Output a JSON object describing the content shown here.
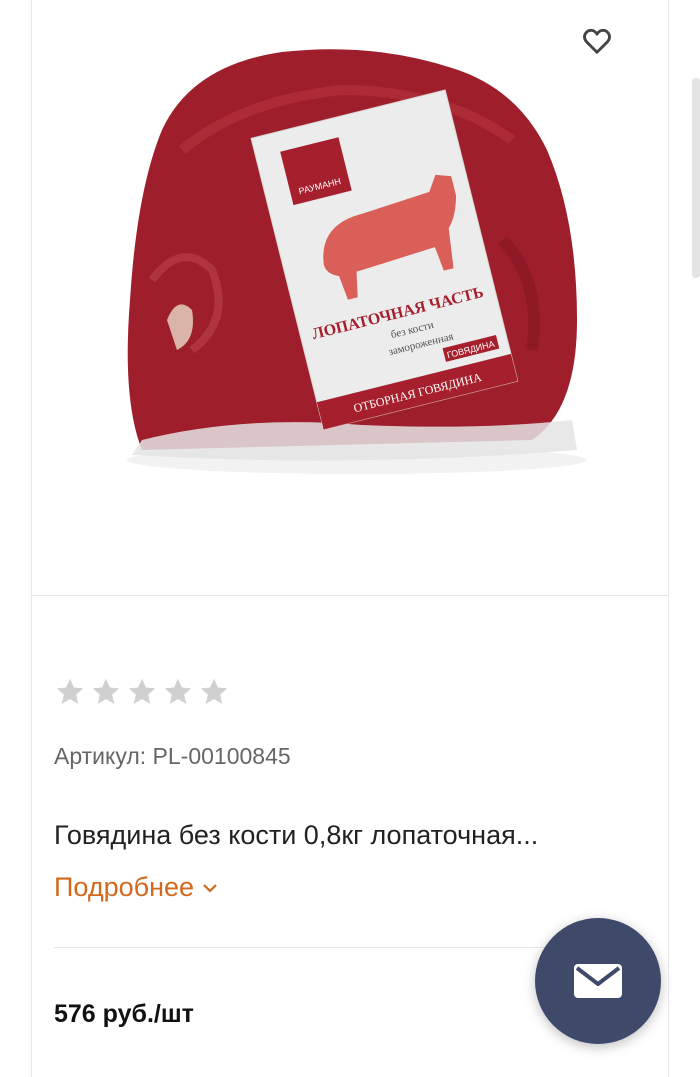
{
  "product": {
    "sku": "Артикул: PL-00100845",
    "title": "Говядина без кости 0,8кг лопаточная...",
    "more_label": "Подробнее",
    "price": "576 руб./шт",
    "rating": {
      "filled": 0,
      "max": 5
    }
  },
  "packaging_label": {
    "brand": "РАУМАНН",
    "line1": "ЛОПАТОЧНАЯ ЧАСТЬ",
    "line2": "без кости",
    "line3": "замороженная",
    "tag": "ГОВЯДИНА",
    "footer": "ОТБОРНАЯ ГОВЯДИНА"
  },
  "icons": {
    "favorite": "heart-outline-icon",
    "more": "chevron-down-icon",
    "mail": "envelope-icon",
    "star": "star-icon"
  },
  "colors": {
    "link": "#d2691e",
    "fab": "#3f4a6b",
    "star_empty": "#d0d0d0",
    "label_red": "#c0392b"
  }
}
